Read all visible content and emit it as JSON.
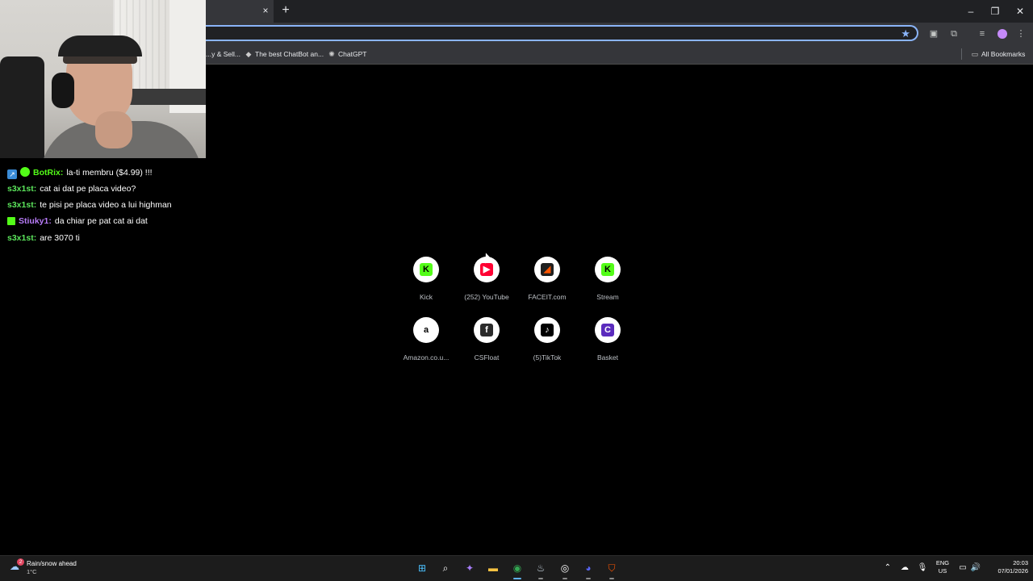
{
  "browser": {
    "tab_close": "×",
    "new_tab": "+",
    "window_controls": {
      "minimize": "–",
      "restore": "❐",
      "close": "✕"
    },
    "star_icon": "★",
    "bookmarks": [
      {
        "label": "...y & Sell...",
        "icon": "store-icon"
      },
      {
        "label": "The best ChatBot an...",
        "icon": "diamond-icon"
      },
      {
        "label": "ChatGPT",
        "icon": "openai-icon"
      }
    ],
    "all_bookmarks": "All Bookmarks"
  },
  "chat": {
    "lines": [
      {
        "user": "BotRix:",
        "message": "la-ti membru ($4.99) !!!",
        "color": "#53fc18",
        "badges": [
          "bot",
          "verified"
        ]
      },
      {
        "user": "s3x1st:",
        "message": "cat ai dat pe placa video?",
        "color": "#5ce65c",
        "badges": []
      },
      {
        "user": "s3x1st:",
        "message": "te pisi pe placa video a lui highman",
        "color": "#5ce65c",
        "badges": []
      },
      {
        "user": "Stiuky1:",
        "message": "da chiar pe pat cat ai dat",
        "color": "#b77bf7",
        "badges": [
          "sub"
        ]
      },
      {
        "user": "s3x1st:",
        "message": "are 3070 ti",
        "color": "#5ce65c",
        "badges": []
      }
    ]
  },
  "shortcuts": [
    {
      "label": "Kick",
      "icon": "kick-icon",
      "glyph": "K",
      "bg": "#53fc18",
      "fg": "#000"
    },
    {
      "label": "(252) YouTube",
      "icon": "youtube-icon",
      "glyph": "▶",
      "bg": "#ff0033",
      "fg": "#fff"
    },
    {
      "label": "FACEIT.com",
      "icon": "faceit-icon",
      "glyph": "◢",
      "bg": "#1f1f1f",
      "fg": "#ff5500"
    },
    {
      "label": "Stream",
      "icon": "kick-icon",
      "glyph": "K",
      "bg": "#53fc18",
      "fg": "#000"
    },
    {
      "label": "Amazon.co.u...",
      "icon": "amazon-icon",
      "glyph": "a",
      "bg": "#ffffff",
      "fg": "#000"
    },
    {
      "label": "CSFloat",
      "icon": "csfloat-icon",
      "glyph": "f",
      "bg": "#2b2b2b",
      "fg": "#fff"
    },
    {
      "label": "(5)TikTok",
      "icon": "tiktok-icon",
      "glyph": "♪",
      "bg": "#000000",
      "fg": "#fff"
    },
    {
      "label": "Basket",
      "icon": "basket-icon",
      "glyph": "C",
      "bg": "#5b2bbd",
      "fg": "#fff"
    }
  ],
  "taskbar": {
    "weather": {
      "text": "Rain/snow ahead",
      "temp": "1°C",
      "badge": "2"
    },
    "apps": [
      {
        "name": "windows-start-icon",
        "glyph": "⊞",
        "color": "#4cc2ff"
      },
      {
        "name": "search-icon",
        "glyph": "⌕",
        "color": "#ffffff"
      },
      {
        "name": "copilot-icon",
        "glyph": "✦",
        "color": "#a57cf7"
      },
      {
        "name": "file-explorer-icon",
        "glyph": "▬",
        "color": "#f5c242"
      },
      {
        "name": "chrome-icon",
        "glyph": "◉",
        "color": "#34a853"
      },
      {
        "name": "steam-icon",
        "glyph": "♨",
        "color": "#c7d5e0"
      },
      {
        "name": "obs-icon",
        "glyph": "◎",
        "color": "#ffffff"
      },
      {
        "name": "discord-icon",
        "glyph": "◕",
        "color": "#5865f2"
      },
      {
        "name": "faceit-ac-icon",
        "glyph": "⛉",
        "color": "#ff5500"
      }
    ],
    "lang_top": "ENG",
    "lang_bottom": "US",
    "time": "20:03",
    "date": "07/01/2026"
  }
}
